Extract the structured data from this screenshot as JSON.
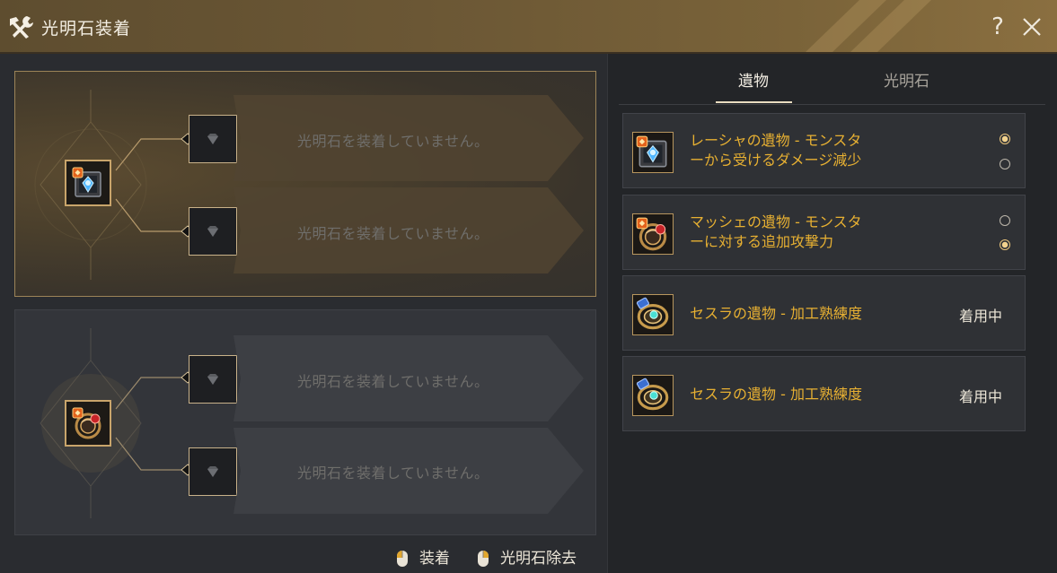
{
  "window": {
    "title": "光明石装着"
  },
  "header": {
    "help_label": "?"
  },
  "slots": [
    {
      "relic_icon": "rasha-relic-icon",
      "stones": [
        {
          "text": "光明石を装着していません。"
        },
        {
          "text": "光明石を装着していません。"
        }
      ]
    },
    {
      "relic_icon": "mashe-relic-icon",
      "stones": [
        {
          "text": "光明石を装着していません。"
        },
        {
          "text": "光明石を装着していません。"
        }
      ]
    }
  ],
  "legend": {
    "equip_label": "装着",
    "remove_label": "光明石除去"
  },
  "tabs": [
    {
      "label": "遺物",
      "active": true
    },
    {
      "label": "光明石",
      "active": false
    }
  ],
  "relics": [
    {
      "name_line1": "レーシャの遺物 - モンスタ",
      "name_line2": "ーから受けるダメージ減少",
      "icon": "rasha-relic-icon",
      "radio": [
        true,
        false
      ]
    },
    {
      "name_line1": "マッシェの遺物 - モンスタ",
      "name_line2": "ーに対する追加攻撃力",
      "icon": "mashe-relic-icon",
      "radio": [
        false,
        true
      ]
    },
    {
      "name_line1": "セスラの遺物 - 加工熟練度",
      "status": "着用中",
      "icon": "sesla-relic-icon"
    },
    {
      "name_line1": "セスラの遺物 - 加工熟練度",
      "status": "着用中",
      "icon": "sesla-relic-icon"
    }
  ],
  "colors": {
    "accent_gold": "#e7b032",
    "title_bar": "#6b5735",
    "panel_bg": "#2a2c30"
  }
}
